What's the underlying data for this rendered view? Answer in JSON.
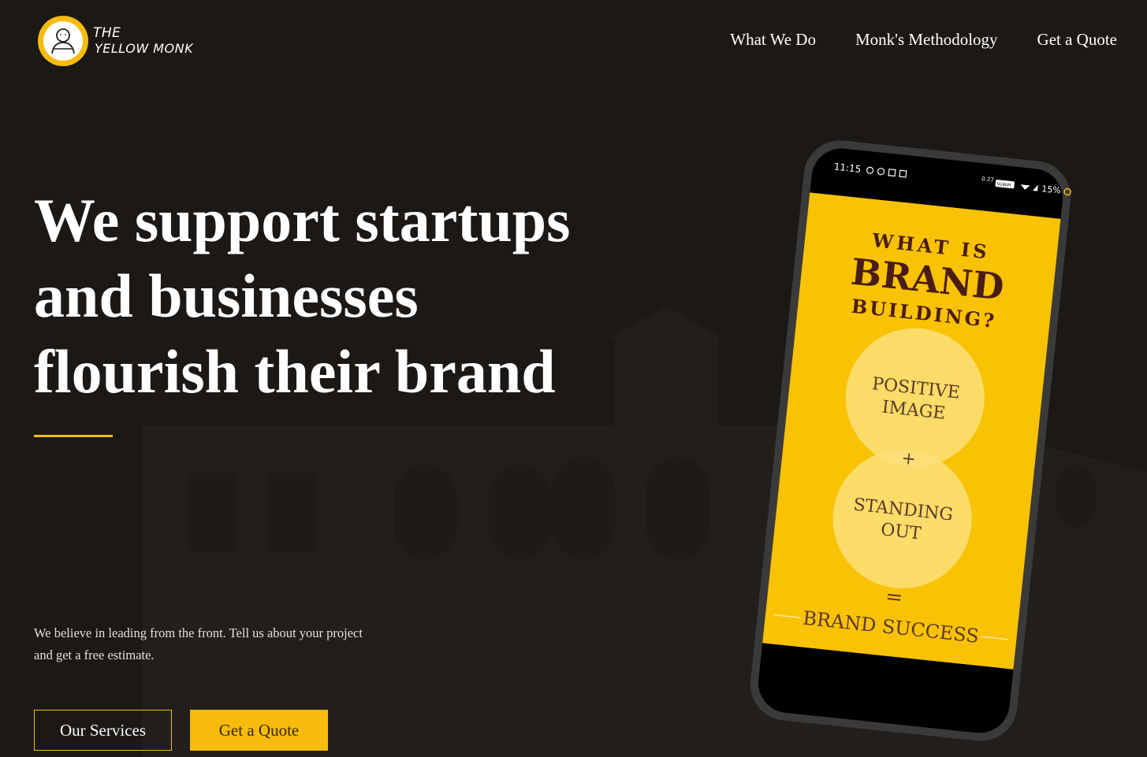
{
  "brand": {
    "logo_line1": "THE",
    "logo_line2": "YELLOW MONK",
    "accent_color": "#f6bb0d"
  },
  "nav": {
    "items": [
      {
        "label": "What We Do"
      },
      {
        "label": "Monk's Methodology"
      },
      {
        "label": "Get a Quote"
      }
    ]
  },
  "hero": {
    "title_lines": [
      "We support startups",
      "and businesses",
      "flourish their brand"
    ],
    "description": "We believe in leading from the front. Tell us about your project and get a free estimate.",
    "primary_button": "Our Services",
    "secondary_button": "Get a Quote"
  },
  "phone": {
    "status_time": "11:15",
    "status_small1": "0.27",
    "status_small2": "VoWiFi",
    "status_battery": "15%",
    "screen": {
      "line1": "WHAT IS",
      "line2": "BRAND",
      "line3": "BUILDING?",
      "circle1_line1": "POSITIVE",
      "circle1_line2": "IMAGE",
      "plus": "+",
      "circle2_line1": "STANDING",
      "circle2_line2": "OUT",
      "equals": "=",
      "result": "BRAND SUCCESS"
    },
    "screen_bg": "#f9c204",
    "text_dark": "#4a1d12"
  }
}
